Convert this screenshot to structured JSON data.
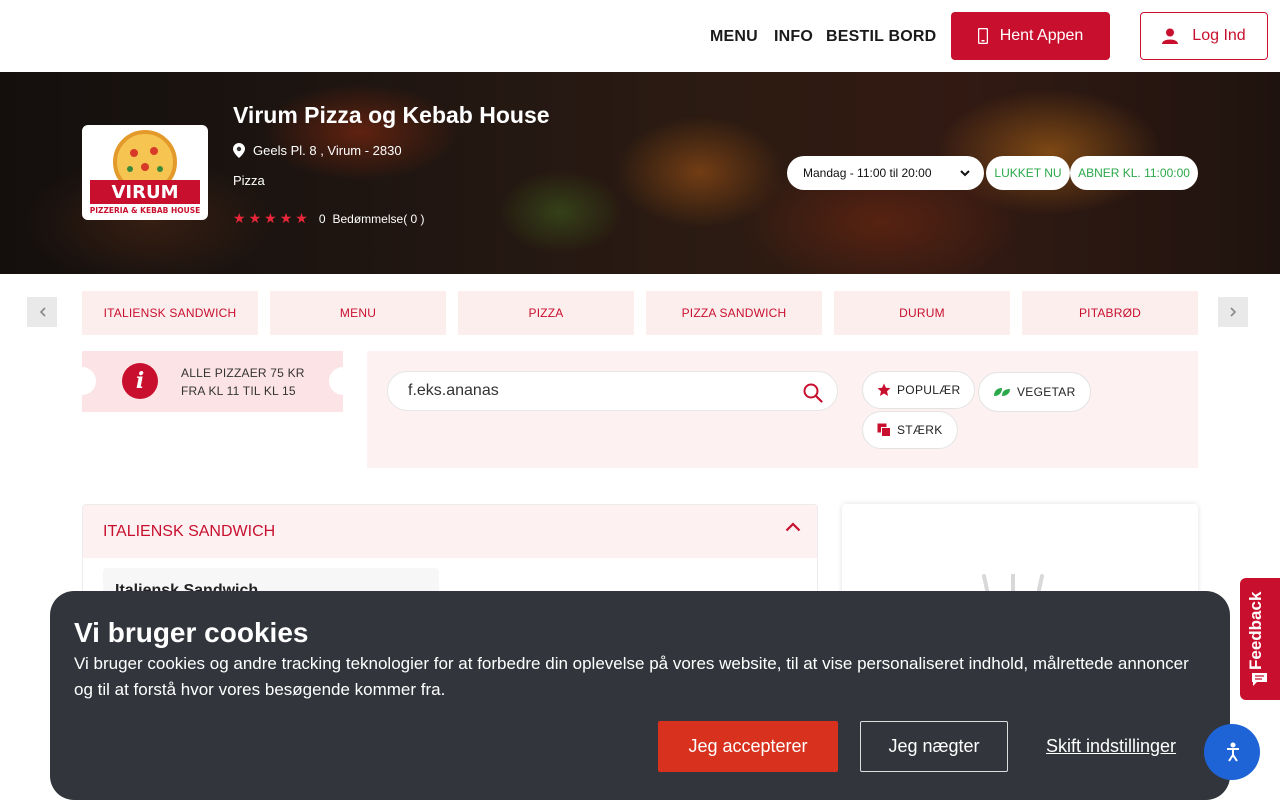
{
  "header": {
    "nav": [
      "MENU",
      "INFO",
      "BESTIL BORD"
    ],
    "app_button": "Hent Appen",
    "login_button": "Log Ind"
  },
  "restaurant": {
    "name": "Virum Pizza og Kebab House",
    "address": "Geels Pl. 8 , Virum - 2830",
    "cuisine": "Pizza",
    "rating_value": "0",
    "rating_label": "Bedømmelse( 0 )",
    "stars": 5,
    "logo_text": "VIRUM",
    "logo_subtext": "PIZZERIA & KEBAB HOUSE",
    "hours": "Mandag - 11:00 til 20:00",
    "status_closed": "LUKKET NU",
    "status_opens": "ABNER KL. 11:00:00"
  },
  "categories": [
    "ITALIENSK SANDWICH",
    "MENU",
    "PIZZA",
    "PIZZA SANDWICH",
    "DURUM",
    "PITABRØD"
  ],
  "offer": {
    "line1": "ALLE PIZZAER 75 KR",
    "line2": "FRA KL 11 TIL KL 15"
  },
  "search": {
    "placeholder": "f.eks.ananas"
  },
  "filters": [
    "POPULÆR",
    "VEGETAR",
    "STÆRK"
  ],
  "section": {
    "title": "ITALIENSK SANDWICH",
    "first_item": "Italiensk Sandwich"
  },
  "cookie": {
    "title": "Vi bruger cookies",
    "text": "Vi bruger cookies og andre tracking teknologier for at forbedre din oplevelse på vores website, til at vise personaliseret indhold, målrettede annoncer og til at forstå hvor vores besøgende kommer fra.",
    "accept": "Jeg accepterer",
    "deny": "Jeg nægter",
    "settings": "Skift indstillinger"
  },
  "feedback": {
    "label": "Feedback"
  },
  "colors": {
    "brand": "#c8102e",
    "open_green": "#2aa84a",
    "cookie_bg": "#32363c",
    "accept": "#d8321f"
  }
}
